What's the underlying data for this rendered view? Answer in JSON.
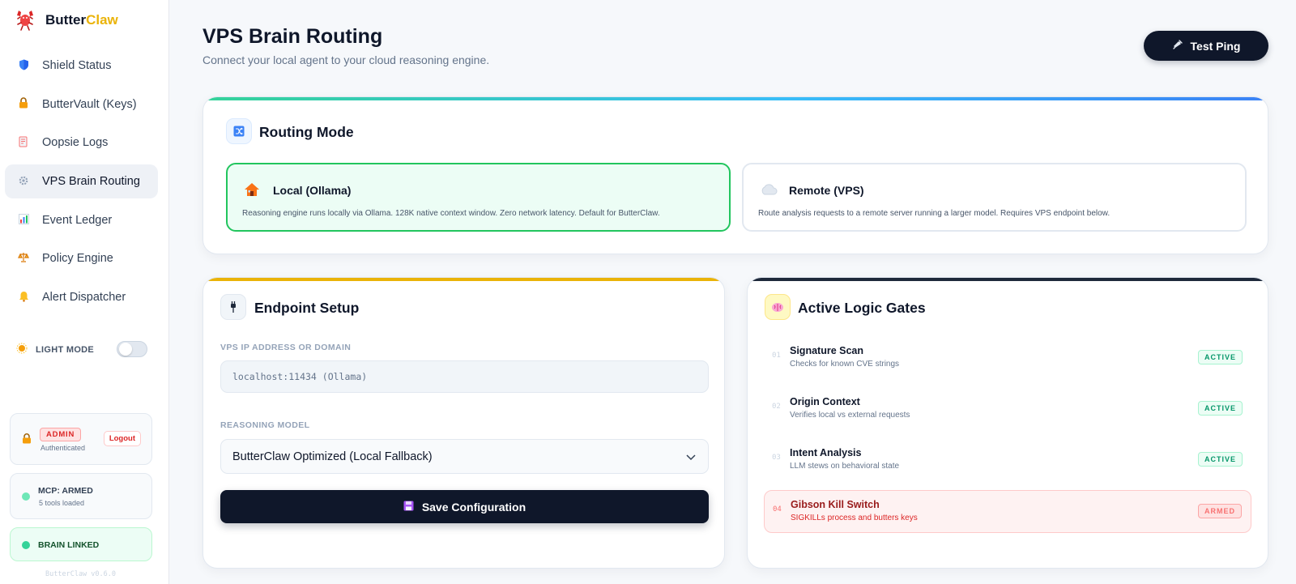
{
  "brand": {
    "name_main": "Butter",
    "name_accent": "Claw",
    "logo_icon": "lobster-icon"
  },
  "nav": {
    "items": [
      {
        "label": "Shield Status",
        "icon": "shield-icon",
        "active": false
      },
      {
        "label": "ButterVault (Keys)",
        "icon": "lock-icon",
        "active": false
      },
      {
        "label": "Oopsie Logs",
        "icon": "memo-icon",
        "active": false
      },
      {
        "label": "VPS Brain Routing",
        "icon": "gear-icon",
        "active": true
      },
      {
        "label": "Event Ledger",
        "icon": "bar-chart-icon",
        "active": false
      },
      {
        "label": "Policy Engine",
        "icon": "scales-icon",
        "active": false
      },
      {
        "label": "Alert Dispatcher",
        "icon": "bell-icon",
        "active": false
      }
    ]
  },
  "theme": {
    "label": "LIGHT MODE",
    "enabled": false
  },
  "auth": {
    "role": "ADMIN",
    "status": "Authenticated",
    "logout_label": "Logout"
  },
  "mcp": {
    "title": "MCP: ARMED",
    "subtitle": "5 tools loaded"
  },
  "brain": {
    "title": "BRAIN LINKED"
  },
  "version": "ButterClaw v0.6.0",
  "header": {
    "title": "VPS Brain Routing",
    "subtitle": "Connect your local agent to your cloud reasoning engine.",
    "ping_label": "Test Ping"
  },
  "routing": {
    "title": "Routing Mode",
    "modes": [
      {
        "title": "Local (Ollama)",
        "desc": "Reasoning engine runs locally via Ollama. 128K native context window. Zero network latency. Default for ButterClaw.",
        "icon": "house-icon",
        "selected": true
      },
      {
        "title": "Remote (VPS)",
        "desc": "Route analysis requests to a remote server running a larger model. Requires VPS endpoint below.",
        "icon": "cloud-icon",
        "selected": false
      }
    ]
  },
  "endpoint": {
    "title": "Endpoint Setup",
    "ip_label": "VPS IP ADDRESS OR DOMAIN",
    "ip_placeholder": "localhost:11434 (Ollama)",
    "model_label": "REASONING MODEL",
    "model_value": "ButterClaw Optimized (Local Fallback)",
    "save_label": "Save Configuration"
  },
  "gates": {
    "title": "Active Logic Gates",
    "items": [
      {
        "num": "01",
        "title": "Signature Scan",
        "desc": "Checks for known CVE strings",
        "status": "ACTIVE"
      },
      {
        "num": "02",
        "title": "Origin Context",
        "desc": "Verifies local vs external requests",
        "status": "ACTIVE"
      },
      {
        "num": "03",
        "title": "Intent Analysis",
        "desc": "LLM stews on behavioral state",
        "status": "ACTIVE"
      },
      {
        "num": "04",
        "title": "Gibson Kill Switch",
        "desc": "SIGKILLs process and butters keys",
        "status": "ARMED"
      }
    ]
  },
  "colors": {
    "accent": "#eab308",
    "success": "#22c55e",
    "danger": "#dc2626",
    "dark": "#0f172a"
  }
}
